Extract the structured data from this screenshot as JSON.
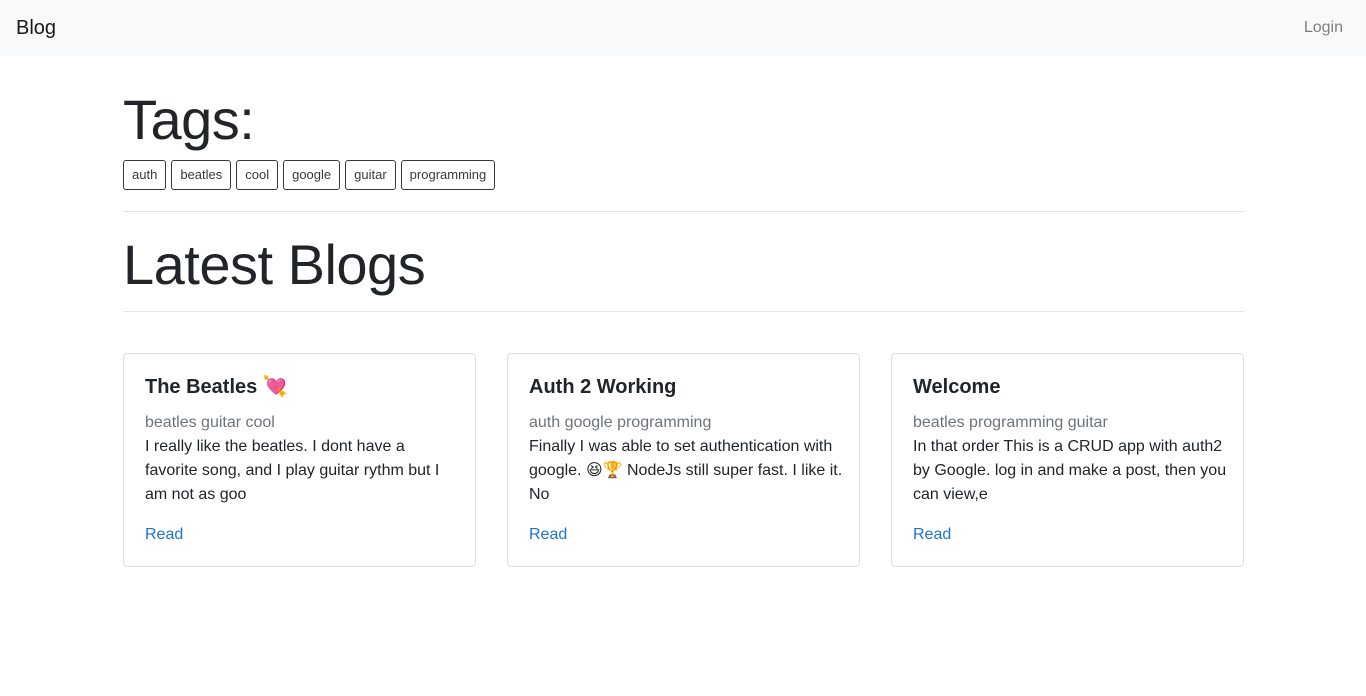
{
  "navbar": {
    "brand": "Blog",
    "login_label": "Login"
  },
  "tags_section": {
    "heading": "Tags:",
    "tags": [
      "auth",
      "beatles",
      "cool",
      "google",
      "guitar",
      "programming"
    ]
  },
  "latest_section": {
    "heading": "Latest Blogs"
  },
  "posts": [
    {
      "title": "The Beatles 💘",
      "tags": "beatles guitar cool",
      "excerpt": "I really like the beatles. I dont have a favorite song, and I play guitar rythm but I am not as goo",
      "link_label": "Read"
    },
    {
      "title": "Auth 2 Working",
      "tags": "auth google programming",
      "excerpt": "Finally I was able to set authentication with google. 😆🏆 NodeJs still super fast. I like it. No",
      "link_label": "Read"
    },
    {
      "title": "Welcome",
      "tags": "beatles programming guitar",
      "excerpt": "In that order This is a CRUD app with auth2 by Google. log in and make a post, then you can view,e",
      "link_label": "Read"
    }
  ],
  "colors": {
    "navbar_bg": "#f8f9fa",
    "link": "#1976d2",
    "muted": "#6c757d",
    "tag_border": "#343a40"
  }
}
